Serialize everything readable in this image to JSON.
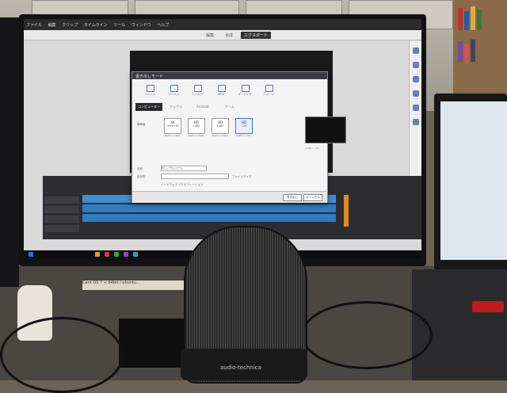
{
  "app": {
    "menu": [
      "ファイル",
      "編集",
      "クリップ",
      "タイムライン",
      "ツール",
      "ウィンドウ",
      "ヘルプ"
    ],
    "modes": [
      "編集",
      "合成",
      "エクスポート"
    ],
    "active_mode": "エクスポート"
  },
  "dialog": {
    "title": "書き出しモード",
    "tabs": [
      "ファイル",
      "デバイス",
      "ディスク",
      "Web",
      "オーディオ",
      "イメージ"
    ],
    "subtabs": [
      "コンピューター",
      "アップル",
      "Android",
      "ゲーム"
    ],
    "active_subtab": "コンピューター",
    "resolution_label": "解像度",
    "resolutions": [
      {
        "top": "4K",
        "bottom": "Ultra HD",
        "note": "3840 × 2160"
      },
      {
        "top": "HD",
        "bottom": "1080",
        "note": "1920 × 1080"
      },
      {
        "top": "HD",
        "bottom": "1080",
        "note": "1920 × 1080"
      },
      {
        "top": "HD",
        "bottom": "720",
        "note": "1280 × 720"
      }
    ],
    "selected_resolution_index": 3,
    "fields": [
      {
        "label": "名前",
        "value": "新しいプロジェクト"
      },
      {
        "label": "保存先",
        "value": ""
      }
    ],
    "file_size_label": "ファイルサイズ",
    "checkbox_label": "ハードウェア アクセラレーション",
    "footer_buttons": [
      "書き出し",
      "キャンセル"
    ]
  },
  "taskbar_colors": [
    "#2f6fd1",
    "#e0a020",
    "#d23b2b",
    "#3aa04a",
    "#7a4fc0",
    "#2aa0c0"
  ],
  "sticker_text": "Cent OS 7 + 64bit / ubuntu...",
  "brand_text": "audio-technica",
  "accent_color": "#3b6fd6"
}
